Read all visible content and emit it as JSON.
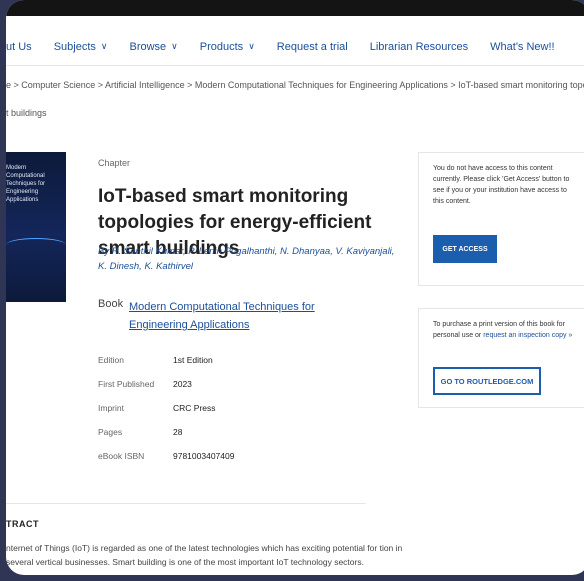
{
  "nav": {
    "items": [
      {
        "label": "ut Us",
        "chevron": false
      },
      {
        "label": "Subjects",
        "chevron": true
      },
      {
        "label": "Browse",
        "chevron": true
      },
      {
        "label": "Products",
        "chevron": true
      },
      {
        "label": "Request a trial",
        "chevron": false
      },
      {
        "label": "Librarian Resources",
        "chevron": false
      },
      {
        "label": "What's New!!",
        "chevron": false
      }
    ]
  },
  "breadcrumb": {
    "line1": "e > Computer Science > Artificial Intelligence > Modern Computational Techniques for Engineering Applications > IoT-based smart monitoring topologies for energy-efficient",
    "line2": "t buildings"
  },
  "cover": {
    "title": "Modern Computational Techniques for Engineering Applications"
  },
  "chapter": {
    "label": "Chapter",
    "title": "IoT-based smart monitoring topologies for energy-efficient smart buildings",
    "authors": "By R. Senthil Kumar, P. Lenin Pugalhanthi, N. Dhanyaa, V. Kaviyanjali, K. Dinesh, K. Kathirvel",
    "book_prefix": "Book",
    "book_title": "Modern Computational Techniques for Engineering Applications"
  },
  "meta": [
    {
      "key": "Edition",
      "value": "1st Edition"
    },
    {
      "key": "First Published",
      "value": "2023"
    },
    {
      "key": "Imprint",
      "value": "CRC Press"
    },
    {
      "key": "Pages",
      "value": "28"
    },
    {
      "key": "eBook ISBN",
      "value": "9781003407409"
    }
  ],
  "access_panel": {
    "text": "You do not have access to this content currently. Please click 'Get Access' button to see if you or your institution have access to this content.",
    "button": "GET ACCESS"
  },
  "purchase_panel": {
    "text": "To purchase a print version of this book for personal use or",
    "link": "request an inspection copy",
    "link_suffix": "»",
    "button": "GO TO ROUTLEDGE.COM"
  },
  "abstract": {
    "heading": "TRACT",
    "text": "nternet of Things (IoT) is regarded as one of the latest technologies which has exciting potential for tion in several vertical businesses. Smart building is one of the most important IoT technology sectors."
  },
  "colors": {
    "link": "#1b4f99",
    "button": "#1b5eae",
    "background": "#2f3554"
  }
}
